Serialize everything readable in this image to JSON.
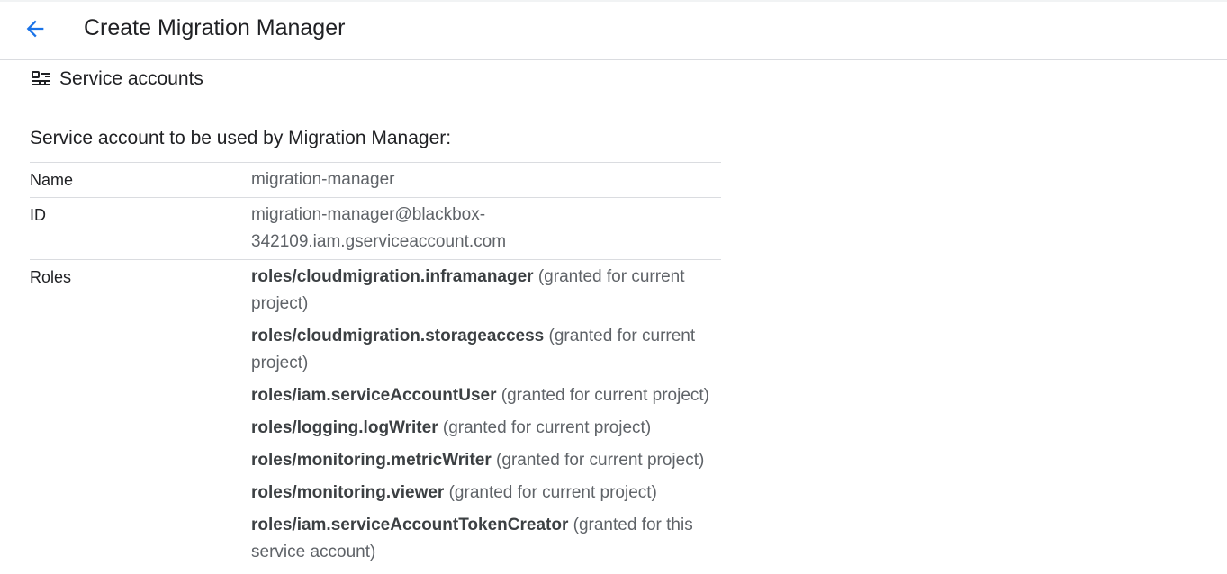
{
  "header": {
    "title": "Create Migration Manager"
  },
  "section": {
    "title": "Service accounts",
    "icon": "service-account-icon"
  },
  "subheading": "Service account to be used by Migration Manager:",
  "details": {
    "name_label": "Name",
    "name_value": "migration-manager",
    "id_label": "ID",
    "id_value_line1": "migration-manager@blackbox-",
    "id_value_line2": "342109.iam.gserviceaccount.com",
    "roles_label": "Roles",
    "roles": [
      {
        "name": "roles/cloudmigration.inframanager",
        "note": " (granted for current project)"
      },
      {
        "name": "roles/cloudmigration.storageaccess",
        "note": " (granted for current project)"
      },
      {
        "name": "roles/iam.serviceAccountUser",
        "note": " (granted for current project)"
      },
      {
        "name": "roles/logging.logWriter",
        "note": " (granted for current project)"
      },
      {
        "name": "roles/monitoring.metricWriter",
        "note": " (granted for current project)"
      },
      {
        "name": "roles/monitoring.viewer",
        "note": " (granted for current project)"
      },
      {
        "name": "roles/iam.serviceAccountTokenCreator",
        "note": " (granted for this service account)"
      }
    ]
  },
  "colors": {
    "accent": "#1a73e8",
    "text": "#202124",
    "secondary": "#5f6368",
    "divider": "#dadce0"
  }
}
